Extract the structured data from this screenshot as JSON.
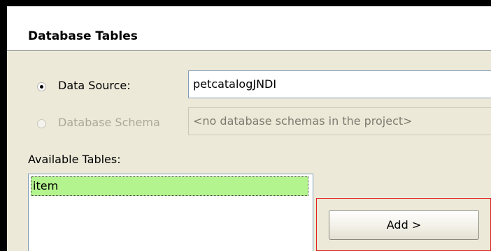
{
  "section": {
    "title": "Database Tables"
  },
  "options": {
    "data_source_label": "Data Source:",
    "data_source_value": "petcatalogJNDI",
    "data_source_selected": true,
    "schema_label": "Database Schema",
    "schema_value": "<no database schemas in the project>",
    "schema_selected": false,
    "schema_enabled": false
  },
  "tables": {
    "label": "Available Tables:",
    "items": [
      "item"
    ],
    "selected": "item"
  },
  "actions": {
    "add_label": "Add >"
  },
  "colors": {
    "selection": "#b4f48f",
    "highlight": "#e0201c",
    "panel": "#ece9d8"
  }
}
